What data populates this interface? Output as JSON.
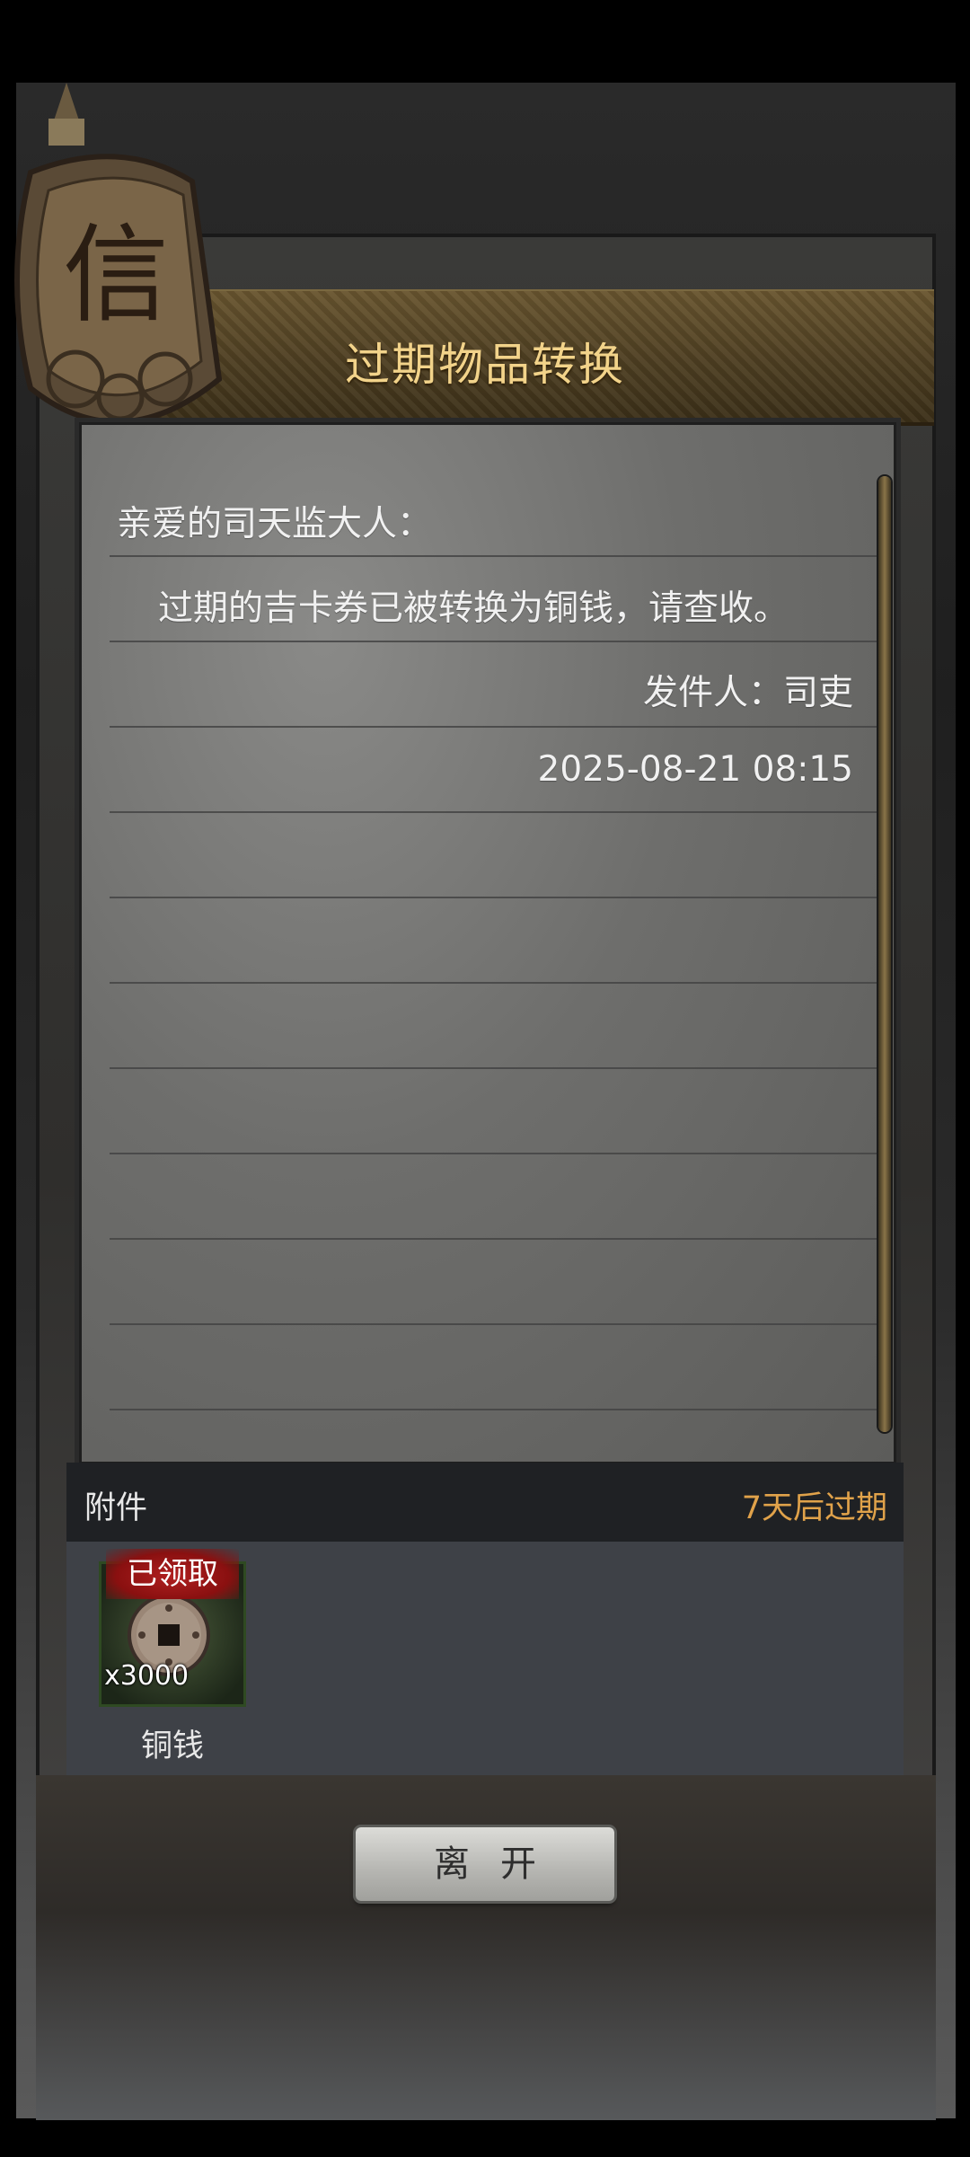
{
  "dialog": {
    "title": "过期物品转换"
  },
  "mail": {
    "greeting": "亲爱的司天监大人：",
    "body": "过期的吉卡券已被转换为铜钱，请查收。",
    "sender": "发件人：司吏",
    "timestamp": "2025-08-21 08:15"
  },
  "attachments": {
    "header_label": "附件",
    "expiry_label": "7天后过期",
    "items": [
      {
        "name": "铜钱",
        "quantity": "x3000",
        "status_badge": "已领取",
        "icon": "copper-coin-icon"
      }
    ]
  },
  "actions": {
    "leave_label": "离开"
  },
  "decor": {
    "medallion_glyph": "信",
    "accent_color": "#f2d38a",
    "expiry_color": "#e0a24a",
    "badge_color": "#b02020"
  }
}
